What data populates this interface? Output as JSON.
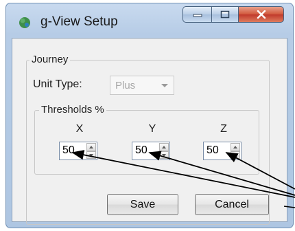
{
  "window": {
    "title": "g-View Setup",
    "icon": "g-view-app-icon",
    "controls": {
      "minimize": "minimize-icon",
      "maximize": "maximize-icon",
      "close": "close-icon"
    }
  },
  "journey": {
    "group_label": "Journey",
    "unit_type_label": "Unit Type:",
    "unit_type_value": "Plus",
    "thresholds": {
      "group_label": "Thresholds %",
      "x_label": "X",
      "y_label": "Y",
      "z_label": "Z",
      "x_value": "50",
      "y_value": "50",
      "z_value": "50"
    }
  },
  "buttons": {
    "save": "Save",
    "cancel": "Cancel"
  },
  "colors": {
    "close_button": "#c0392b",
    "titlebar": "#c9daef",
    "arrows": "#000000"
  }
}
